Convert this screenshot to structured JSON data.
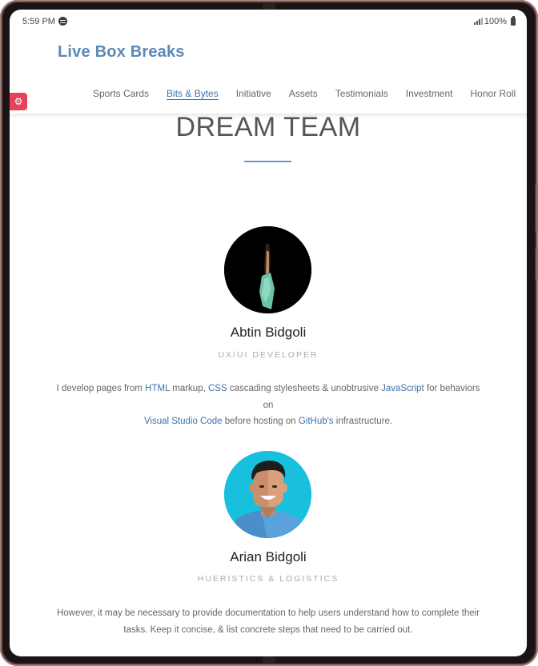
{
  "status": {
    "time": "5:59 PM",
    "battery": "100%"
  },
  "brand": {
    "name": "Live Box Breaks"
  },
  "nav": {
    "items": [
      "Sports Cards",
      "Bits & Bytes",
      "Initiative",
      "Assets",
      "Testimonials",
      "Investment",
      "Honor Roll"
    ],
    "active_index": 1
  },
  "section": {
    "title": "DREAM TEAM"
  },
  "members": [
    {
      "name": "Abtin Bidgoli",
      "role": "UX/UI DEVELOPER",
      "bio": {
        "t1": "I develop pages from ",
        "l1": "HTML",
        "t2": " markup, ",
        "l2": "CSS",
        "t3": " cascading stylesheets & unobtrusive ",
        "l3": "JavaScript",
        "t4": " for behaviors on",
        "l4": "Visual Studio Code",
        "t5": " before hosting on ",
        "l5": "GitHub's",
        "t6": " infrastructure."
      }
    },
    {
      "name": "Arian Bidgoli",
      "role": "HUERISTICS & LOGISTICS",
      "bio": {
        "line1": "However, it may be necessary to provide documentation to help users understand how to complete their",
        "line2": "tasks. Keep it concise, & list concrete steps that need to be carried out."
      }
    }
  ],
  "colors": {
    "brand": "#5b89b8",
    "link": "#3f73a8",
    "accent_rule": "#6b95bf",
    "settings_tab": "#e8425a",
    "avatar2_bg": "#18c0de"
  }
}
